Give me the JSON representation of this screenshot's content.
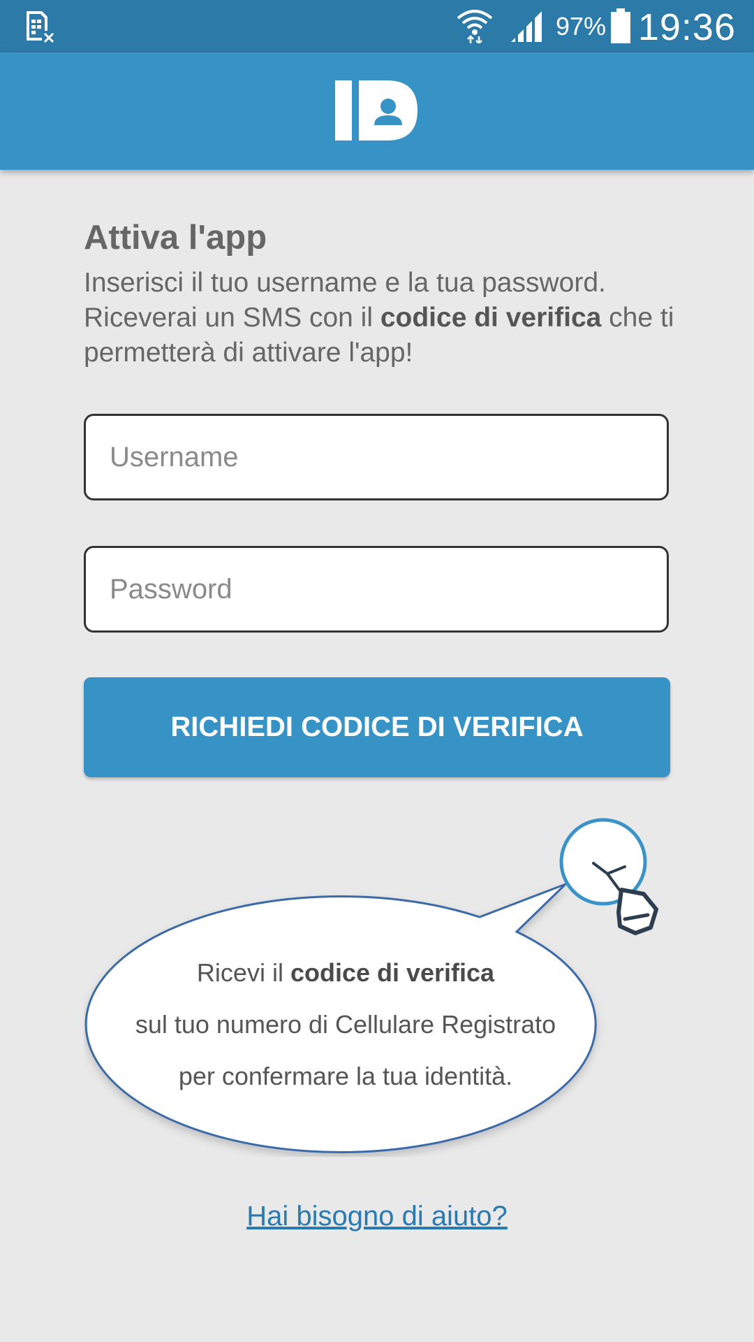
{
  "status_bar": {
    "icons": [
      "sim-card-off-icon",
      "wifi-icon",
      "cellular-signal-icon",
      "battery-icon"
    ],
    "battery_percent": "97%",
    "time": "19:36"
  },
  "app_bar": {
    "logo_icon": "id-user-logo-icon"
  },
  "activation": {
    "title": "Attiva l'app",
    "intro_part1": "Inserisci il tuo username e la tua password. Riceverai un SMS con il ",
    "intro_bold": "codice di verifica",
    "intro_part2": " che ti permetterà di attivare l'app!"
  },
  "form": {
    "username_placeholder": "Username",
    "username_value": "",
    "password_placeholder": "Password",
    "password_value": "",
    "submit_label": "RICHIEDI CODICE DI VERIFICA"
  },
  "tip": {
    "icon": "lightbulb-icon",
    "line1_prefix": "Ricevi il ",
    "line1_bold": "codice di verifica",
    "line2": "sul tuo numero di Cellulare Registrato",
    "line3": "per confermare la tua identità."
  },
  "help": {
    "link_label": "Hai bisogno di aiuto?"
  },
  "colors": {
    "status_bar": "#2b7aa8",
    "primary": "#3792c6",
    "background": "#e9e9e9",
    "link": "#2a7ab0"
  }
}
